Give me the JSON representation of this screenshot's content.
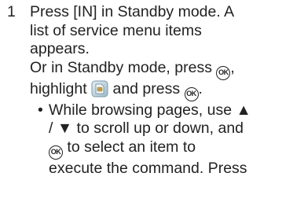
{
  "step": {
    "number": "1",
    "line1": "Press [IN] in Standby mode. A",
    "line2": "list of service menu items",
    "line3": "appears.",
    "line4": "Or in Standby mode, press",
    "line4_end": ",",
    "line5_start": "highlight",
    "line5_mid": "and press",
    "line5_end": ".",
    "ok_icon_text": "OK",
    "ok_icon_name": "ok-key",
    "menu_icon_name": "service-menu-sim-icon"
  },
  "bullet": {
    "mark": "•",
    "line1": "While browsing pages, use ▲",
    "line2": "/ ▼ to scroll up or down, and",
    "line3_end": "to select an item to",
    "line4": "execute the command. Press"
  }
}
